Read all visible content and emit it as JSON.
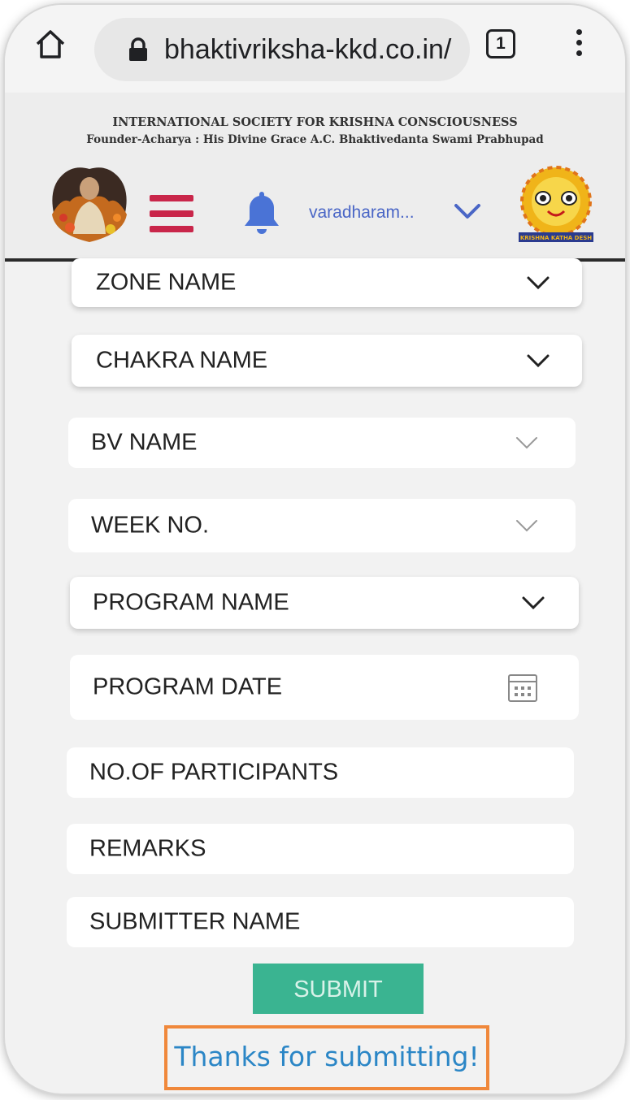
{
  "browser": {
    "url": "bhaktivriksha-kkd.co.in/",
    "tab_count": "1"
  },
  "header": {
    "org_title": "INTERNATIONAL SOCIETY FOR KRISHNA CONSCIOUSNESS",
    "founder": "Founder-Acharya : His Divine Grace A.C. Bhaktivedanta Swami Prabhupad",
    "username": "varadharam...",
    "logo_text": "KRISHNA KATHA DESH"
  },
  "form": {
    "zone_name": "ZONE NAME",
    "chakra_name": "CHAKRA NAME",
    "bv_name": "BV NAME",
    "week_no": "WEEK NO.",
    "program_name": "PROGRAM NAME",
    "program_date": "PROGRAM DATE",
    "participants": "NO.OF PARTICIPANTS",
    "remarks": "REMARKS",
    "submitter_name": "SUBMITTER NAME",
    "submit_label": "SUBMIT"
  },
  "message": {
    "thanks": "Thanks for submitting!"
  },
  "colors": {
    "accent_red": "#c9264a",
    "bell_blue": "#4a73d6",
    "submit_green": "#3ab491",
    "thanks_blue": "#2b86c6",
    "highlight_orange": "#f0883b"
  }
}
